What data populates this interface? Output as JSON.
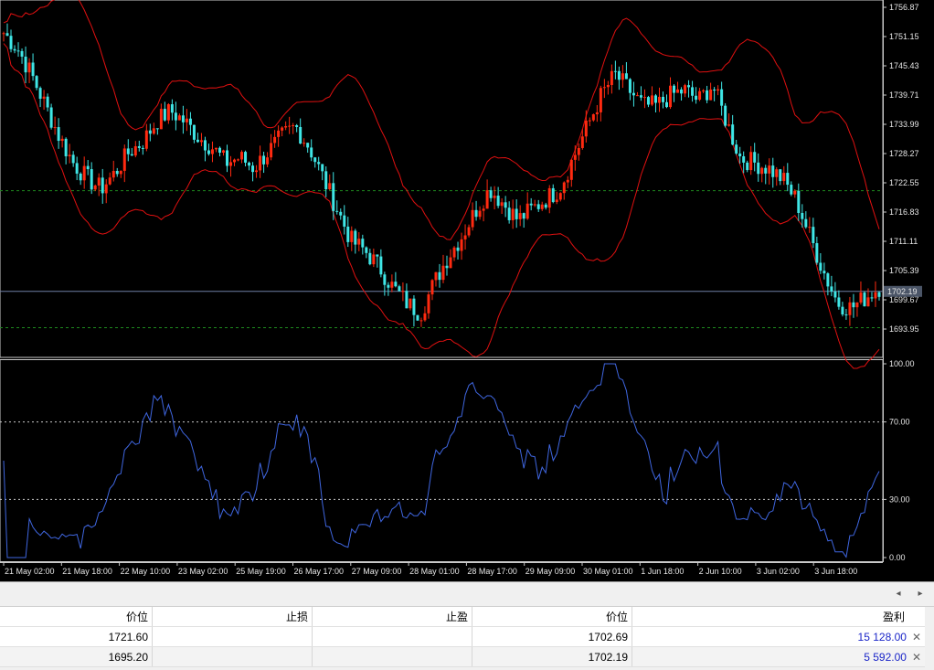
{
  "chart": {
    "price_axis_labels": [
      "1756.87",
      "1751.15",
      "1745.43",
      "1739.71",
      "1733.99",
      "1728.27",
      "1722.55",
      "1716.83",
      "1711.11",
      "1705.39",
      "1699.67",
      "1693.95"
    ],
    "current_price_label": "1702.19",
    "rsi_axis_labels": [
      "100.00",
      "70.00",
      "30.00",
      "0.00"
    ],
    "time_labels": [
      "21 May 02:00",
      "21 May 18:00",
      "22 May 10:00",
      "23 May 02:00",
      "25 May 19:00",
      "26 May 17:00",
      "27 May 09:00",
      "28 May 01:00",
      "28 May 17:00",
      "29 May 09:00",
      "30 May 01:00",
      "1 Jun 18:00",
      "2 Jun 10:00",
      "3 Jun 02:00",
      "3 Jun 18:00"
    ],
    "colors": {
      "bull": "#ff2a10",
      "bear": "#3fe6e6",
      "bands": "#e01010",
      "rsi": "#3f66e0",
      "grid_level": "#1e8a1e",
      "price_line": "#6f7fa6"
    },
    "price_range": [
      1690.0,
      1758.0
    ],
    "rsi_range": [
      0,
      100
    ],
    "rsi_levels": [
      70,
      30
    ],
    "horizontal_levels": {
      "green_upper": 1721.6,
      "green_lower": 1695.2,
      "current": 1702.19
    },
    "price_path": [
      1752,
      1749,
      1744,
      1738,
      1732,
      1727,
      1724,
      1722,
      1725,
      1729,
      1731,
      1735,
      1737,
      1735,
      1732,
      1730,
      1727,
      1728,
      1726,
      1729,
      1732,
      1734,
      1730,
      1724,
      1718,
      1712,
      1710,
      1707,
      1703,
      1700,
      1698,
      1704,
      1709,
      1713,
      1718,
      1722,
      1719,
      1716,
      1718,
      1720,
      1722,
      1728,
      1734,
      1740,
      1744,
      1741,
      1738,
      1738,
      1740,
      1741,
      1739,
      1742,
      1735,
      1728,
      1727,
      1726,
      1724,
      1720,
      1713,
      1706,
      1700,
      1699,
      1701,
      1703
    ]
  },
  "positions_table": {
    "headers": [
      "价位",
      "止损",
      "止盈",
      "价位",
      "盈利"
    ],
    "rows": [
      {
        "open_price": "1721.60",
        "sl": "",
        "tp": "",
        "current": "1702.69",
        "profit": "15 128.00"
      },
      {
        "open_price": "1695.20",
        "sl": "",
        "tp": "",
        "current": "1702.19",
        "profit": "5 592.00"
      }
    ],
    "close_glyph": "✕"
  },
  "scroll": {
    "left": "◂",
    "right": "▸"
  }
}
